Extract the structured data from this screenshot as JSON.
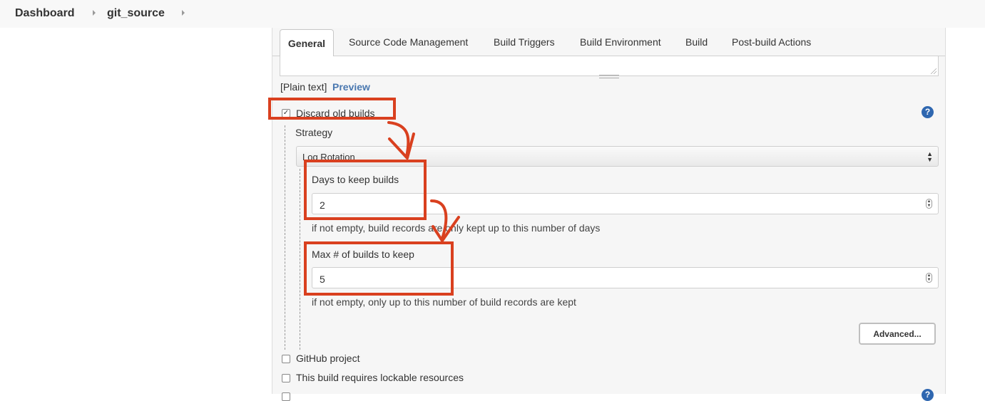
{
  "breadcrumb": {
    "home": "Dashboard",
    "job": "git_source"
  },
  "tabs": [
    "General",
    "Source Code Management",
    "Build Triggers",
    "Build Environment",
    "Build",
    "Post-build Actions"
  ],
  "description": {
    "format": "[Plain text]",
    "preview": "Preview"
  },
  "discard": {
    "label": "Discard old builds",
    "checked": true,
    "strategy_label": "Strategy",
    "strategy_value": "Log Rotation",
    "days_label": "Days to keep builds",
    "days_value": "2",
    "days_hint": "if not empty, build records are only kept up to this number of days",
    "max_label": "Max # of builds to keep",
    "max_value": "5",
    "max_hint": "if not empty, only up to this number of build records are kept",
    "advanced": "Advanced..."
  },
  "options": {
    "github_project": "GitHub project",
    "lockable": "This build requires lockable resources"
  },
  "help_glyph": "?",
  "colors": {
    "annotation": "#d9401f",
    "link": "#4a78b0",
    "help": "#2f67b0"
  }
}
